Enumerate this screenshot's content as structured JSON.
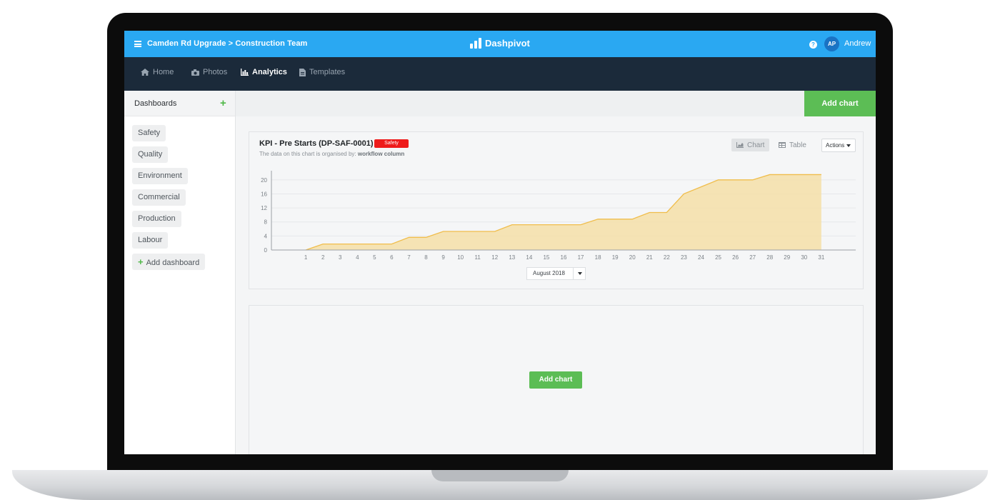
{
  "header": {
    "breadcrumb": "Camden Rd Upgrade > Construction Team",
    "brand": "Dashpivot",
    "avatar_initials": "AP",
    "user_name": "Andrew",
    "help_glyph": "?"
  },
  "nav": {
    "items": [
      {
        "label": "Home",
        "icon": "home-icon"
      },
      {
        "label": "Photos",
        "icon": "camera-icon"
      },
      {
        "label": "Analytics",
        "icon": "bar-chart-icon"
      },
      {
        "label": "Templates",
        "icon": "document-icon"
      }
    ],
    "active": "Analytics"
  },
  "sidebar": {
    "title": "Dashboards",
    "items": [
      "Safety",
      "Quality",
      "Environment",
      "Commercial",
      "Production",
      "Labour"
    ],
    "add_label": "Add dashboard"
  },
  "toolbar": {
    "add_chart_label": "Add chart"
  },
  "card": {
    "title": "KPI - Pre Starts (DP-SAF-0001)",
    "badge": "Safety",
    "subtitle_prefix": "The data on this chart is organised by:",
    "subtitle_value": "workflow column",
    "toggle_chart": "Chart",
    "toggle_table": "Table",
    "actions_label": "Actions",
    "month": "August 2018"
  },
  "empty_card": {
    "add_chart_label": "Add chart"
  },
  "colors": {
    "topbar": "#2aa8f2",
    "navbar": "#1b2a3a",
    "accent_green": "#5cbd55",
    "badge_red": "#ee1b1b",
    "area_fill": "#f5dfa8",
    "area_line": "#f0bd4b"
  },
  "chart_data": {
    "type": "area",
    "x": [
      1,
      2,
      3,
      4,
      5,
      6,
      7,
      8,
      9,
      10,
      11,
      12,
      13,
      14,
      15,
      16,
      17,
      18,
      19,
      20,
      21,
      22,
      23,
      24,
      25,
      26,
      27,
      28,
      29,
      30,
      31
    ],
    "series": [
      {
        "values": [
          0,
          1.7,
          1.7,
          1.7,
          1.7,
          1.7,
          3.6,
          3.6,
          5.3,
          5.3,
          5.3,
          5.3,
          7.2,
          7.2,
          7.2,
          7.2,
          7.2,
          8.8,
          8.8,
          8.8,
          10.7,
          10.7,
          16,
          18,
          20,
          20,
          20,
          21.5,
          21.5,
          21.5,
          21.5
        ]
      }
    ],
    "yticks": [
      0,
      4,
      8,
      12,
      16,
      20
    ],
    "ylim": [
      0,
      22
    ],
    "xlim": [
      -1,
      33
    ],
    "grid": true
  }
}
